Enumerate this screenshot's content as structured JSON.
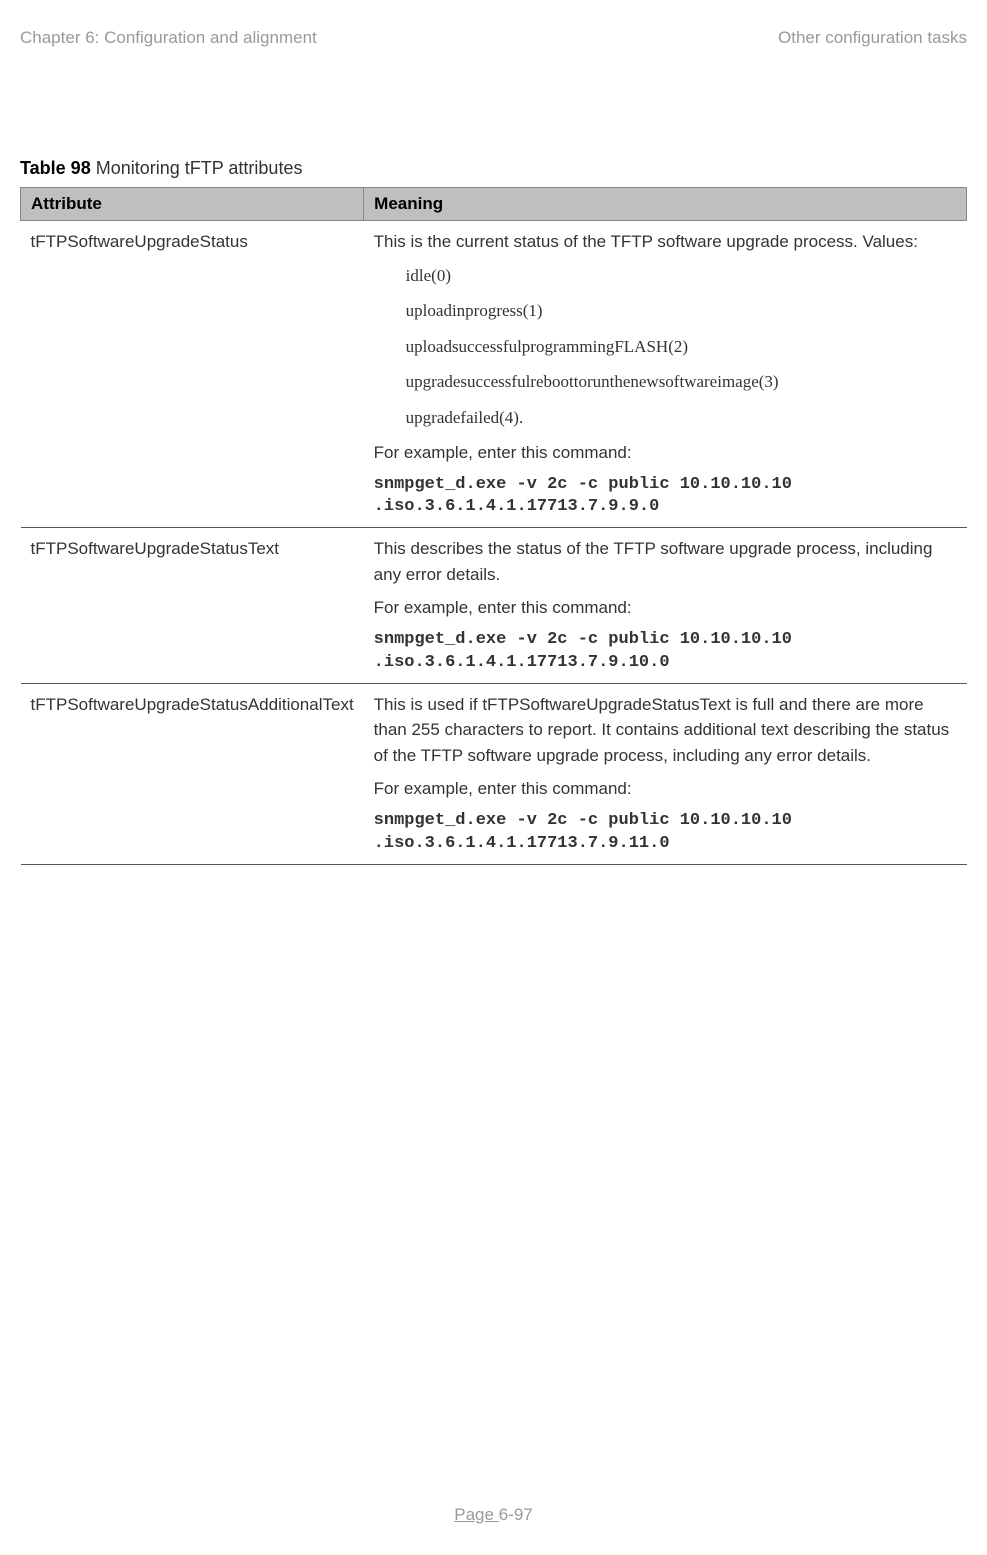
{
  "header": {
    "left": "Chapter 6:  Configuration and alignment",
    "right": "Other configuration tasks"
  },
  "caption": {
    "label": "Table 98",
    "title": "  Monitoring tFTP attributes"
  },
  "columns": {
    "attribute": "Attribute",
    "meaning": "Meaning"
  },
  "rows": [
    {
      "attribute": "tFTPSoftwareUpgradeStatus",
      "intro": "This is the current status of the TFTP software upgrade process. Values:",
      "values": [
        "idle(0)",
        "uploadinprogress(1)",
        "uploadsuccessfulprogrammingFLASH(2)",
        "upgradesuccessfulreboottorunthenewsoftwareimage(3)",
        "upgradefailed(4)."
      ],
      "example_label": "For example, enter this command:",
      "command": "snmpget_d.exe -v 2c -c public 10.10.10.10 .iso.3.6.1.4.1.17713.7.9.9.0"
    },
    {
      "attribute": "tFTPSoftwareUpgradeStatusText",
      "description": "This describes the status of the TFTP software upgrade process, including any error details.",
      "example_label": "For example, enter this command:",
      "command": "snmpget_d.exe -v 2c -c public 10.10.10.10 .iso.3.6.1.4.1.17713.7.9.10.0"
    },
    {
      "attribute": "tFTPSoftwareUpgradeStatusAdditionalText",
      "description": "This is used if tFTPSoftwareUpgradeStatusText is full and there are more than 255 characters to report. It contains additional text describing the status of the TFTP software upgrade process, including any error details.",
      "example_label": "For example, enter this command:",
      "command": "snmpget_d.exe -v 2c -c public 10.10.10.10 .iso.3.6.1.4.1.17713.7.9.11.0"
    }
  ],
  "footer": {
    "page_label": "Page ",
    "page_number": "6-97"
  }
}
